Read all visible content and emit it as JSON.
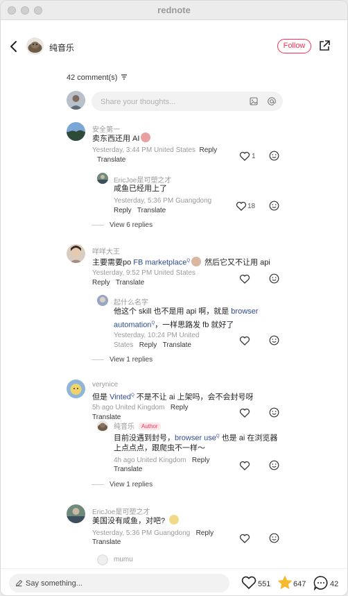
{
  "window": {
    "title": "rednote"
  },
  "header": {
    "author_name": "纯音乐",
    "follow_label": "Follow"
  },
  "comments_header": {
    "count_label": "42 comment(s)"
  },
  "input": {
    "placeholder": "Share your thoughts..."
  },
  "comments": [
    {
      "user": "安全第一",
      "text": "卖东西还用 AI",
      "time": "Yesterday, 3:44 PM United States",
      "reply_label": "Reply",
      "translate_label": "Translate",
      "likes": "1",
      "replies": [
        {
          "user": "EricJoe是可塑之才",
          "text": "咸鱼已经用上了",
          "time": "Yesterday, 5:36 PM Guangdong",
          "reply_label": "Reply",
          "translate_label": "Translate",
          "likes": "18"
        }
      ],
      "view_more": "View 6 replies"
    },
    {
      "user": "咩咩大王",
      "text_before": "主要需要po ",
      "link": "FB marketplace",
      "text_after": " 然后它又不让用 api",
      "time": "Yesterday, 9:52 PM United States",
      "reply_label": "Reply",
      "translate_label": "Translate",
      "replies": [
        {
          "user": "起什么名字",
          "text_line1_before": "他这个 skill 也不是用 api 啊，就是 ",
          "link1": "browser",
          "link2": "automation",
          "text_line2_after": "，一样思路发 fb 就好了",
          "time_line1": "Yesterday, 10:24 PM United",
          "time_line2": "States",
          "reply_label": "Reply",
          "translate_label": "Translate"
        }
      ],
      "view_more": "View 1 replies"
    },
    {
      "user": "verynice",
      "text_before": "但是 ",
      "link": "Vinted",
      "text_after": " 不是不让 ai 上架吗，会不会封号呀",
      "time": "5h ago United Kingdom",
      "reply_label": "Reply",
      "translate_label": "Translate",
      "replies": [
        {
          "user": "纯音乐",
          "tag": "Author",
          "text_line1_before": "目前没遇到封号，",
          "link": "browser use",
          "text_line1_after": " 也是 ai 在浏览器",
          "text_line2": "上点点点，跟爬虫不一样～",
          "time": "4h ago United Kingdom",
          "reply_label": "Reply",
          "translate_label": "Translate"
        }
      ],
      "view_more": "View 1 replies"
    },
    {
      "user": "EricJoe是可塑之才",
      "text": "美国没有咸鱼，对吧?",
      "time": "Yesterday, 5:36 PM Guangdong",
      "reply_label": "Reply",
      "translate_label": "Translate"
    },
    {
      "user": "mumu"
    }
  ],
  "bottom_bar": {
    "placeholder": "Say something...",
    "likes": "551",
    "collects": "647",
    "comments": "42"
  },
  "colors": {
    "accent": "#ff2e4d",
    "link": "#2d4b8e",
    "star": "#f5b82e"
  }
}
